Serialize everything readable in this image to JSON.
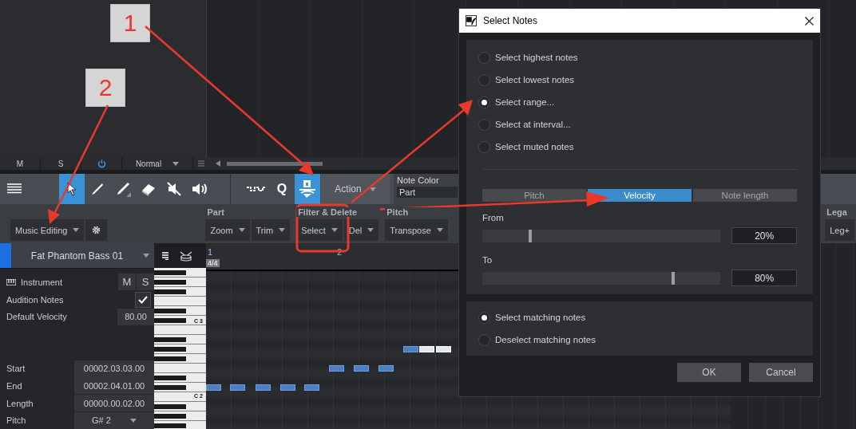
{
  "track_controls": {
    "mute": "M",
    "solo": "S",
    "power": true,
    "mode": "Normal"
  },
  "toolbar": {
    "tools": [
      {
        "kind": "arrow",
        "selected": true
      },
      {
        "kind": "pencil",
        "selected": false
      },
      {
        "kind": "paint",
        "selected": false
      },
      {
        "kind": "eraser",
        "selected": false
      },
      {
        "kind": "mute",
        "selected": false
      },
      {
        "kind": "speaker",
        "selected": false
      }
    ],
    "edit_tools": [
      {
        "kind": "wave",
        "selected": false
      },
      {
        "kind": "quantize",
        "label": "Q",
        "selected": false
      },
      {
        "kind": "edit",
        "selected": true
      }
    ],
    "action": "Action",
    "note_color": {
      "label": "Note Color",
      "value": "Part"
    }
  },
  "sections": {
    "layout_button": "Music Editing",
    "groups": [
      {
        "title": "Part",
        "buttons": [
          "Zoom",
          "Trim"
        ]
      },
      {
        "title": "Filter & Delete",
        "buttons": [
          "Select",
          "Del"
        ]
      },
      {
        "title": "Pitch",
        "buttons": [
          "Transpose"
        ]
      }
    ],
    "edge_group": {
      "title": "Lega",
      "button": "Leg+"
    }
  },
  "inspector": {
    "track_name": "Fat Phantom Bass 01",
    "instrument_label": "Instrument",
    "mute": "M",
    "solo": "S",
    "audition_label": "Audition Notes",
    "audition": true,
    "velocity_label": "Default Velocity",
    "velocity": "80.00",
    "fields": [
      {
        "label": "Start",
        "value": "00002.03.03.00",
        "kind": "value"
      },
      {
        "label": "End",
        "value": "00002.04.01.00",
        "kind": "value"
      },
      {
        "label": "Length",
        "value": "00000.00.02.00",
        "kind": "value"
      },
      {
        "label": "Pitch",
        "value": "G# 2",
        "kind": "dropdown"
      }
    ]
  },
  "keyboard": {
    "labels": [
      "C 3",
      "C 2"
    ]
  },
  "ruler": {
    "bars": [
      "1",
      "2"
    ],
    "signature": "4/4"
  },
  "notes": [
    {
      "selected": false
    },
    {
      "selected": false
    },
    {
      "selected": false
    },
    {
      "selected": false
    },
    {
      "selected": false
    },
    {
      "selected": false
    },
    {
      "selected": false
    },
    {
      "selected": false
    },
    {
      "selected": false
    },
    {
      "selected": true
    },
    {
      "selected": true
    }
  ],
  "dialog": {
    "title": "Select Notes",
    "options": [
      {
        "label": "Select highest notes",
        "selected": false
      },
      {
        "label": "Select lowest notes",
        "selected": false
      },
      {
        "label": "Select range...",
        "selected": true
      },
      {
        "label": "Select at interval...",
        "selected": false
      },
      {
        "label": "Select muted notes",
        "selected": false
      }
    ],
    "tabs": [
      {
        "label": "Pitch",
        "selected": false
      },
      {
        "label": "Velocity",
        "selected": true
      },
      {
        "label": "Note length",
        "selected": false
      }
    ],
    "ranges": [
      {
        "label": "From",
        "level": 0.2,
        "value": "20%"
      },
      {
        "label": "To",
        "level": 0.8,
        "value": "80%"
      }
    ],
    "actions": [
      {
        "label": "Select matching notes",
        "selected": true
      },
      {
        "label": "Deselect matching notes",
        "selected": false
      }
    ],
    "buttons": [
      "OK",
      "Cancel"
    ]
  },
  "callouts": [
    "1",
    "2"
  ]
}
